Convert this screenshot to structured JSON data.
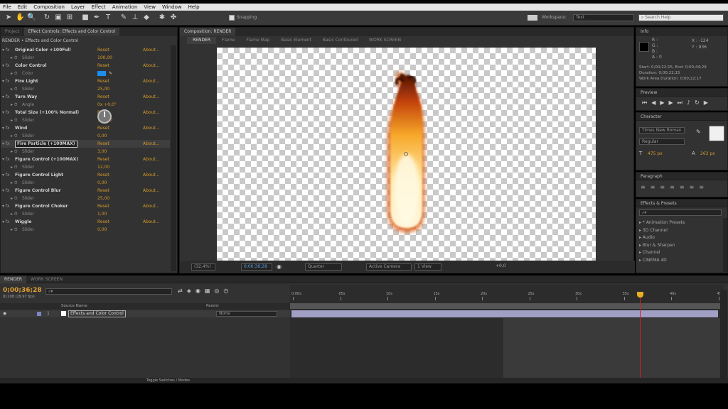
{
  "menu": [
    "File",
    "Edit",
    "Composition",
    "Layer",
    "Effect",
    "Animation",
    "View",
    "Window",
    "Help"
  ],
  "toolbar": {
    "snapping_label": "Snapping",
    "workspace_label": "Workspace:",
    "workspace_value": "Text",
    "search_placeholder": "Search Help"
  },
  "effect_controls": {
    "tabs": [
      "Project",
      "Effect Controls: Effects and Color Control"
    ],
    "breadcrumb": "RENDER • Effects and Color Control",
    "rows": [
      {
        "kind": "fx",
        "label": "Original Color +100Full",
        "v1": "Reset",
        "v2": "About..."
      },
      {
        "kind": "sub",
        "label": "Slider",
        "v1": "100,00",
        "v2": ""
      },
      {
        "kind": "fx",
        "label": "Color Control",
        "v1": "Reset",
        "v2": "About..."
      },
      {
        "kind": "sub",
        "label": "Color",
        "v1": "",
        "v2": ""
      },
      {
        "kind": "fx",
        "label": "Fire Light",
        "v1": "Reset",
        "v2": "About..."
      },
      {
        "kind": "sub",
        "label": "Slider",
        "v1": "25,00",
        "v2": ""
      },
      {
        "kind": "fx",
        "label": "Turn Way",
        "v1": "Reset",
        "v2": "About..."
      },
      {
        "kind": "sub",
        "label": "Angle",
        "v1": "0x +0,0°",
        "v2": ""
      },
      {
        "kind": "fx",
        "label": "Total Size (+100% Normal)",
        "v1": "Reset",
        "v2": "About..."
      },
      {
        "kind": "sub",
        "label": "Slider",
        "v1": "100,00",
        "v2": ""
      },
      {
        "kind": "fx",
        "label": "Wind",
        "v1": "Reset",
        "v2": "About..."
      },
      {
        "kind": "sub",
        "label": "Slider",
        "v1": "0,00",
        "v2": ""
      },
      {
        "kind": "fx",
        "label": "Fire Particle (+100MAX)",
        "v1": "Reset",
        "v2": "About...",
        "highlight": true
      },
      {
        "kind": "sub",
        "label": "Slider",
        "v1": "3,00",
        "v2": ""
      },
      {
        "kind": "fx",
        "label": "Figure Control (+100MAX)",
        "v1": "Reset",
        "v2": "About..."
      },
      {
        "kind": "sub",
        "label": "Slider",
        "v1": "12,00",
        "v2": ""
      },
      {
        "kind": "fx",
        "label": "Figure Control Light",
        "v1": "Reset",
        "v2": "About..."
      },
      {
        "kind": "sub",
        "label": "Slider",
        "v1": "0,00",
        "v2": ""
      },
      {
        "kind": "fx",
        "label": "Figure Control Blur",
        "v1": "Reset",
        "v2": "About..."
      },
      {
        "kind": "sub",
        "label": "Slider",
        "v1": "25,00",
        "v2": ""
      },
      {
        "kind": "fx",
        "label": "Figure Control Choker",
        "v1": "Reset",
        "v2": "About..."
      },
      {
        "kind": "sub",
        "label": "Slider",
        "v1": "1,00",
        "v2": ""
      },
      {
        "kind": "fx",
        "label": "Wiggle",
        "v1": "Reset",
        "v2": "About..."
      },
      {
        "kind": "sub",
        "label": "Slider",
        "v1": "0,00",
        "v2": ""
      }
    ]
  },
  "composition": {
    "tab": "Composition: RENDER",
    "flow_tabs": [
      "RENDER",
      "Flame",
      "Flame Map",
      "Basic Element",
      "Basic Contoured",
      "WORK SCREEN"
    ],
    "zoom": "(32,4%)",
    "time": "0;00;36;28",
    "resolution": "Quarter",
    "camera": "Active Camera",
    "views": "1 View",
    "exposure": "+0,0"
  },
  "info": {
    "title": "Info",
    "r": "R :",
    "g": "G :",
    "b": "B :",
    "a": "A : 0",
    "x": "X : -124",
    "y": "Y : 936",
    "start_end": "Start: 0;00;22;15, End: 0;00;44;29",
    "duration": "Duration: 0;00;22;15",
    "work_area": "Work Area Duration: 0;00;22;17"
  },
  "preview": {
    "title": "Preview"
  },
  "character": {
    "title": "Character",
    "font": "Times New Roman",
    "style": "Regular",
    "size": "475 px",
    "leading": "263 px"
  },
  "paragraph": {
    "title": "Paragraph"
  },
  "effects_presets": {
    "title": "Effects & Presets",
    "items": [
      "* Animation Presets",
      "3D Channel",
      "Audio",
      "Blur & Sharpen",
      "Channel",
      "CINEMA 4D"
    ]
  },
  "timeline": {
    "tabs": [
      "RENDER",
      "WORK SCREEN"
    ],
    "timecode": "0;00;36;28",
    "timecode_sub": "01108 (29.97 fps)",
    "source_header": "Source Name",
    "parent_header": "Parent",
    "layer_num": "1",
    "layer_name": "Effects and Color Control",
    "parent_value": "None",
    "ruler": [
      "0:00s",
      "05s",
      "10s",
      "15s",
      "20s",
      "25s",
      "30s",
      "35s",
      "40s",
      "45s"
    ],
    "toggle_label": "Toggle Switches / Modes"
  }
}
